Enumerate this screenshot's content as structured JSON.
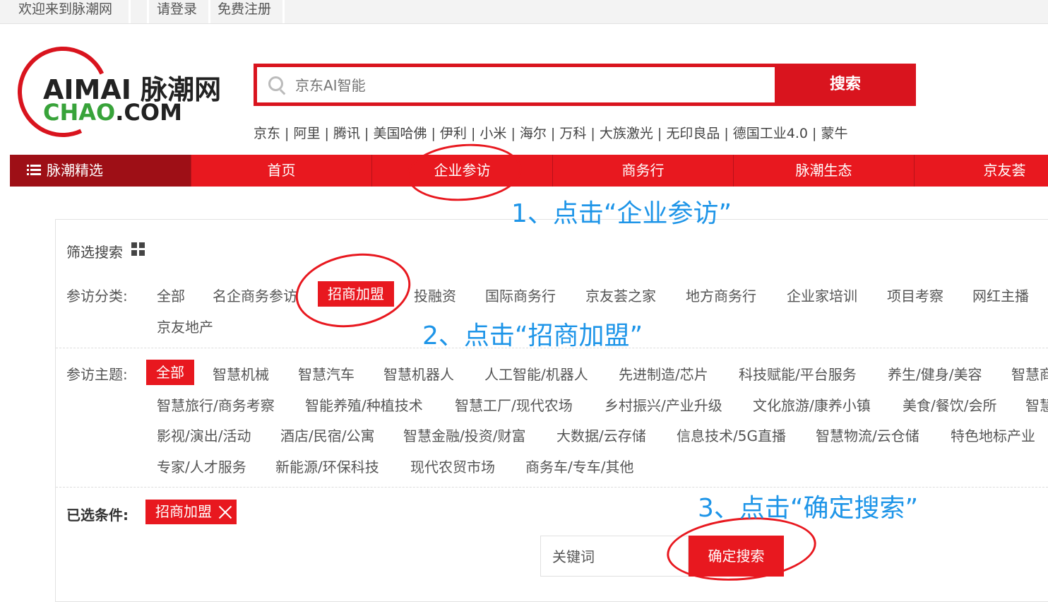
{
  "topbar": {
    "welcome": "欢迎来到脉潮网",
    "login": "请登录",
    "register": "免费注册"
  },
  "logo": {
    "line1": "AIMAI 脉潮网",
    "line2_a": "CHAO",
    "line2_b": ".COM"
  },
  "search": {
    "placeholder": "京东AI智能",
    "button": "搜索"
  },
  "hotwords": "京东 | 阿里 | 腾讯 | 美国哈佛 | 伊利 | 小米 | 海尔 | 万科 | 大族激光 | 无印良品 | 德国工业4.0 | 蒙牛",
  "nav": {
    "featured": "脉潮精选",
    "items": [
      "首页",
      "企业参访",
      "商务行",
      "脉潮生态",
      "京友荟"
    ]
  },
  "filter": {
    "title": "筛选搜索",
    "category_label": "参访分类:",
    "categories": [
      "全部",
      "名企商务参访",
      "招商加盟",
      "投融资",
      "国际商务行",
      "京友荟之家",
      "地方商务行",
      "企业家培训",
      "项目考察",
      "网红主播",
      "京友地产"
    ],
    "category_selected": "招商加盟",
    "theme_label": "参访主题:",
    "themes_row1": [
      "全部",
      "智慧机械",
      "智慧汽车",
      "智慧机器人",
      "人工智能/机器人",
      "先进制造/芯片",
      "科技赋能/平台服务",
      "养生/健身/美容",
      "智慧商"
    ],
    "themes_row2": [
      "智慧旅行/商务考察",
      "智能养殖/种植技术",
      "智慧工厂/现代农场",
      "乡村振兴/产业升级",
      "文化旅游/康养小镇",
      "美食/餐饮/会所",
      "智慧"
    ],
    "themes_row3": [
      "影视/演出/活动",
      "酒店/民宿/公寓",
      "智慧金融/投资/财富",
      "大数据/云存储",
      "信息技术/5G直播",
      "智慧物流/云仓储",
      "特色地标产业"
    ],
    "themes_row4": [
      "专家/人才服务",
      "新能源/环保科技",
      "现代农贸市场",
      "商务车/专车/其他"
    ],
    "chosen_label": "已选条件:",
    "chosen_chip": "招商加盟",
    "keyword_placeholder": "关键词",
    "confirm_button": "确定搜索"
  },
  "annotations": {
    "step1": "1、点击“企业参访”",
    "step2": "2、点击“招商加盟”",
    "step3": "3、点击“确定搜索”"
  },
  "colors": {
    "brand_red": "#e8181f",
    "dark_red": "#9e0f16",
    "annotation_blue": "#1e95e8",
    "logo_green": "#38a33a"
  }
}
